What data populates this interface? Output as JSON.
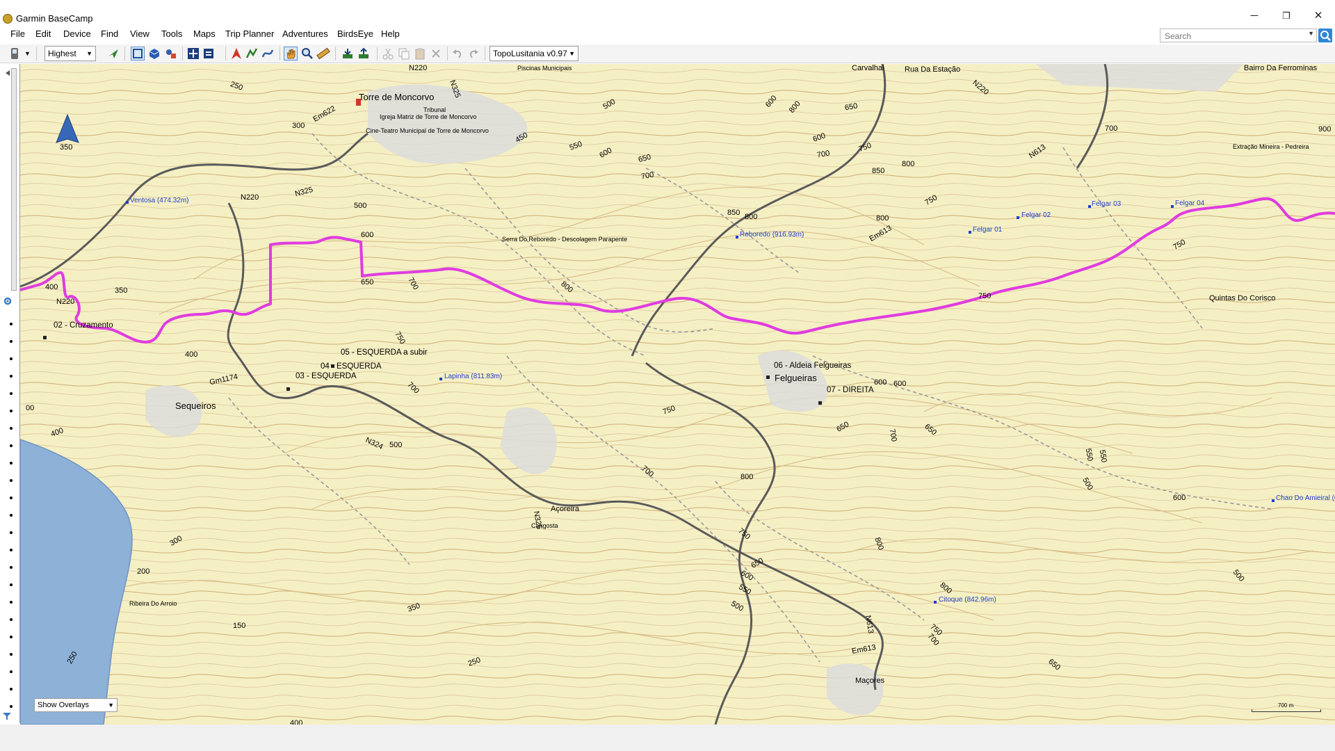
{
  "window": {
    "title": "Garmin BaseCamp",
    "minimize": "─",
    "restore": "❐",
    "close": "✕"
  },
  "menu": [
    "File",
    "Edit",
    "Device",
    "Find",
    "View",
    "Tools",
    "Maps",
    "Trip Planner",
    "Adventures",
    "BirdsEye",
    "Help"
  ],
  "search": {
    "placeholder": "Search"
  },
  "toolbar": {
    "detail": "Highest",
    "map_product": "TopoLusitania v0.97",
    "icons": [
      "device-icon",
      "send-icon",
      "select-icon",
      "3d-view-icon",
      "split-view-icon",
      "zoom-extent-icon",
      "transfer-icon",
      "new-waypoint-icon",
      "new-route-icon",
      "new-track-icon",
      "hand-tool-icon",
      "zoom-tool-icon",
      "measure-tool-icon",
      "receive-icon",
      "send-device-icon",
      "cut-icon",
      "copy-icon",
      "paste-icon",
      "delete-icon",
      "undo-icon",
      "redo-icon"
    ]
  },
  "map": {
    "overlays_label": "Show Overlays",
    "scale_label": "700 m",
    "north_label": "350",
    "colors": {
      "track": "#e03ce0",
      "water": "#8eb1d8",
      "contour": "#d9bf8e",
      "road": "#555555",
      "background": "#f5efc4"
    },
    "places": {
      "torre": "Torre de Moncorvo",
      "carvalhal": "Carvalhal",
      "rua_estacao": "Rua Da Estação",
      "bairro": "Bairro Da Ferrominas",
      "piscinas": "Piscinas Municipais",
      "igreja": "Igreja Matriz de Torre de Moncorvo",
      "cine": "Cine-Teatro Municipal de Torre de Moncorvo",
      "tribunal": "Tribunal",
      "extracao": "Extração Mineira - Pedreira",
      "serra": "Serra Do Reboredo - Descolagem Parapente",
      "sequeiros": "Sequeiros",
      "felgueiras": "Felgueiras",
      "quintas": "Quintas Do Corisco",
      "acoreira": "Açoreira",
      "macores": "Maçores",
      "ribeira": "Ribeira Do Arroio",
      "cangosta": "Cangosta"
    },
    "waypoints": {
      "w02": "02 - Cruzamento",
      "w03": "03 - ESQUERDA",
      "w04": "04 - ESQUERDA",
      "w05": "05 - ESQUERDA a subir",
      "w06": "06 - Aldeia Felgueiras",
      "w07": "07 - DIREITA"
    },
    "peaks": {
      "ventosa": "Ventosa (474.32m)",
      "reboredo": "Reboredo (916.93m)",
      "lapinha": "Lapinha (811.83m)",
      "citoque": "Citoque (842.96m)",
      "felgar01": "Felgar 01",
      "felgar02": "Felgar 02",
      "felgar03": "Felgar 03",
      "felgar04": "Felgar 04",
      "chao": "Chao Do Amieiral (63"
    },
    "roads": {
      "n220a": "N220",
      "n220b": "N220",
      "n220c": "N220",
      "n220d": "N220",
      "n325": "N325",
      "em622": "Em622",
      "n613": "N613",
      "em613a": "Em613",
      "em613b": "Em613",
      "n613b": "N613",
      "gm1174": "Gm1174",
      "n324": "N324",
      "n325b": "N325",
      "n325c": "N325"
    },
    "contours": {
      "c1": "250",
      "c2": "300",
      "c3": "500",
      "c4": "600",
      "c5": "650",
      "c6": "700",
      "c7": "750",
      "c8": "800",
      "c9": "850",
      "c10": "900",
      "c11": "550",
      "c12": "650",
      "c13": "700",
      "c14": "800",
      "c15": "850",
      "c16": "600",
      "c17": "650",
      "c18": "800",
      "c19": "750",
      "c20": "600",
      "c21": "700",
      "c22": "750",
      "c23": "400",
      "c24": "350",
      "c25": "400",
      "c26": "400",
      "c27": "500",
      "c28": "700",
      "c29": "750",
      "c30": "700",
      "c31": "800",
      "c32": "600",
      "c33": "650",
      "c34": "700",
      "c35": "650",
      "c36": "550",
      "c37": "500",
      "c38": "600",
      "c39": "750",
      "c40": "650",
      "c41": "600",
      "c42": "550",
      "c43": "500",
      "c44": "800",
      "c45": "800",
      "c46": "700",
      "c47": "750",
      "c48": "650",
      "c49": "500",
      "c50": "300",
      "c51": "200",
      "c52": "150",
      "c53": "350",
      "c54": "250",
      "c55": "250",
      "c56": "400",
      "c57": "00",
      "c58": "450",
      "c59": "700",
      "c60": "800",
      "c61": "600",
      "c62": "750",
      "c63": "500",
      "c64": "600",
      "c65": "750",
      "c66": "800",
      "c67": "550"
    }
  }
}
